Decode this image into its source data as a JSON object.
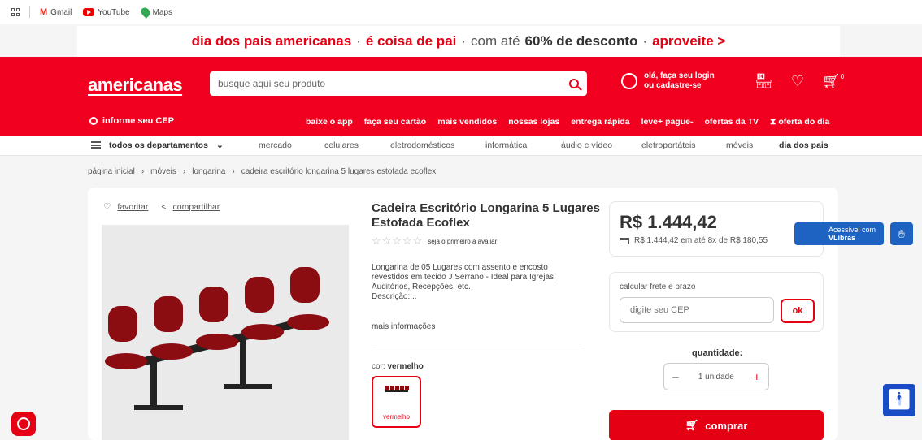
{
  "bookmarks": {
    "items": [
      "Gmail",
      "YouTube",
      "Maps"
    ]
  },
  "promo": {
    "part1": "dia dos pais americanas",
    "sep": "·",
    "part2": "é coisa de pai",
    "part3_pre": "com até",
    "part3_bold": "60% de desconto",
    "part4": "aproveite >"
  },
  "header": {
    "logo": "americanas",
    "search_placeholder": "busque aqui seu produto",
    "login_line1": "olá, faça seu login",
    "login_line2": "ou cadastre-se",
    "cart_count": "0",
    "cep": "informe seu CEP",
    "links": [
      "baixe o app",
      "faça seu cartão",
      "mais vendidos",
      "nossas lojas",
      "entrega rápida",
      "leve+ pague-",
      "ofertas da TV",
      "oferta do dia"
    ]
  },
  "nav": {
    "all_departments": "todos os departamentos",
    "categories": [
      "mercado",
      "celulares",
      "eletrodomésticos",
      "informática",
      "áudio e vídeo",
      "eletroportáteis",
      "móveis",
      "dia dos pais"
    ]
  },
  "breadcrumb": [
    "página inicial",
    "móveis",
    "longarina",
    "cadeira escritório longarina 5 lugares estofada ecoflex"
  ],
  "product": {
    "favorite": "favoritar",
    "share": "compartilhar",
    "title": "Cadeira Escritório Longarina 5 Lugares Estofada Ecoflex",
    "rating_text": "seja o primeiro a avaliar",
    "description": "Longarina de 05 Lugares com assento e encosto revestidos em tecido J Serrano - Ideal para Igrejas, Auditórios, Recepções, etc.\n Descrição:...",
    "more_info": "mais informações",
    "color_label": "cor:",
    "color_value": "vermelho",
    "swatch_label": "vermelho",
    "price": "R$ 1.444,42",
    "installments": "R$ 1.444,42 em até 8x de R$ 180,55",
    "shipping_label": "calcular frete e prazo",
    "cep_placeholder": "digite seu CEP",
    "ok": "ok",
    "quantity_label": "quantidade:",
    "quantity_value": "1 unidade",
    "buy": "comprar"
  },
  "vlibras": {
    "line1": "Acessível com",
    "line2": "VLibras"
  },
  "colors": {
    "brand_red": "#e60014",
    "vlibras_blue": "#1e63c2"
  }
}
